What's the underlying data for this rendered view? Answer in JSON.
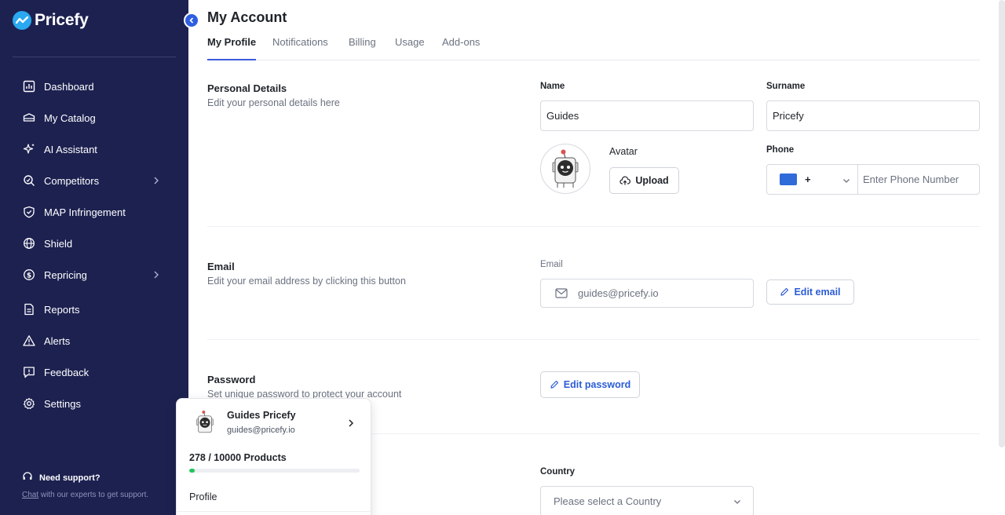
{
  "brand": {
    "name": "Pricefy",
    "accent": "#2aa8f0",
    "sidebar_bg": "#1d2150"
  },
  "sidebar": {
    "items": [
      {
        "label": "Dashboard",
        "icon": "dashboard-icon"
      },
      {
        "label": "My Catalog",
        "icon": "catalog-icon"
      },
      {
        "label": "AI Assistant",
        "icon": "sparkle-icon"
      },
      {
        "label": "Competitors",
        "icon": "competitors-icon",
        "has_submenu": true
      },
      {
        "label": "MAP Infringement",
        "icon": "shield-check-icon"
      },
      {
        "label": "Shield",
        "icon": "globe-icon"
      },
      {
        "label": "Repricing",
        "icon": "dollar-refresh-icon",
        "has_submenu": true
      },
      {
        "label": "Reports",
        "icon": "report-icon"
      },
      {
        "label": "Alerts",
        "icon": "warning-icon"
      },
      {
        "label": "Feedback",
        "icon": "feedback-icon"
      },
      {
        "label": "Settings",
        "icon": "gear-icon"
      }
    ],
    "support": {
      "title": "Need support?",
      "chat_link": "Chat",
      "text": " with our experts to get support."
    }
  },
  "page": {
    "title": "My Account",
    "tabs": [
      {
        "label": "My Profile",
        "active": true
      },
      {
        "label": "Notifications",
        "active": false
      },
      {
        "label": "Billing",
        "active": false
      },
      {
        "label": "Usage",
        "active": false
      },
      {
        "label": "Add-ons",
        "active": false
      }
    ]
  },
  "personal": {
    "title": "Personal Details",
    "subtitle": "Edit your personal details here",
    "name_label": "Name",
    "name_value": "Guides",
    "surname_label": "Surname",
    "surname_value": "Pricefy",
    "avatar_label": "Avatar",
    "upload_label": "Upload",
    "phone_label": "Phone",
    "phone_prefix": "+",
    "phone_placeholder": "Enter Phone Number"
  },
  "email": {
    "title": "Email",
    "subtitle": "Edit your email address by clicking this button",
    "label": "Email",
    "value": "guides@pricefy.io",
    "edit_label": "Edit email"
  },
  "password": {
    "title": "Password",
    "subtitle": "Set unique password to protect your account",
    "edit_label": "Edit password"
  },
  "country": {
    "label": "Country",
    "placeholder": "Please select a Country"
  },
  "user_popup": {
    "name": "Guides Pricefy",
    "email": "guides@pricefy.io",
    "products_text": "278 / 10000 Products",
    "products_used": 278,
    "products_total": 10000,
    "profile_label": "Profile",
    "bar_color": "#22c55e"
  }
}
